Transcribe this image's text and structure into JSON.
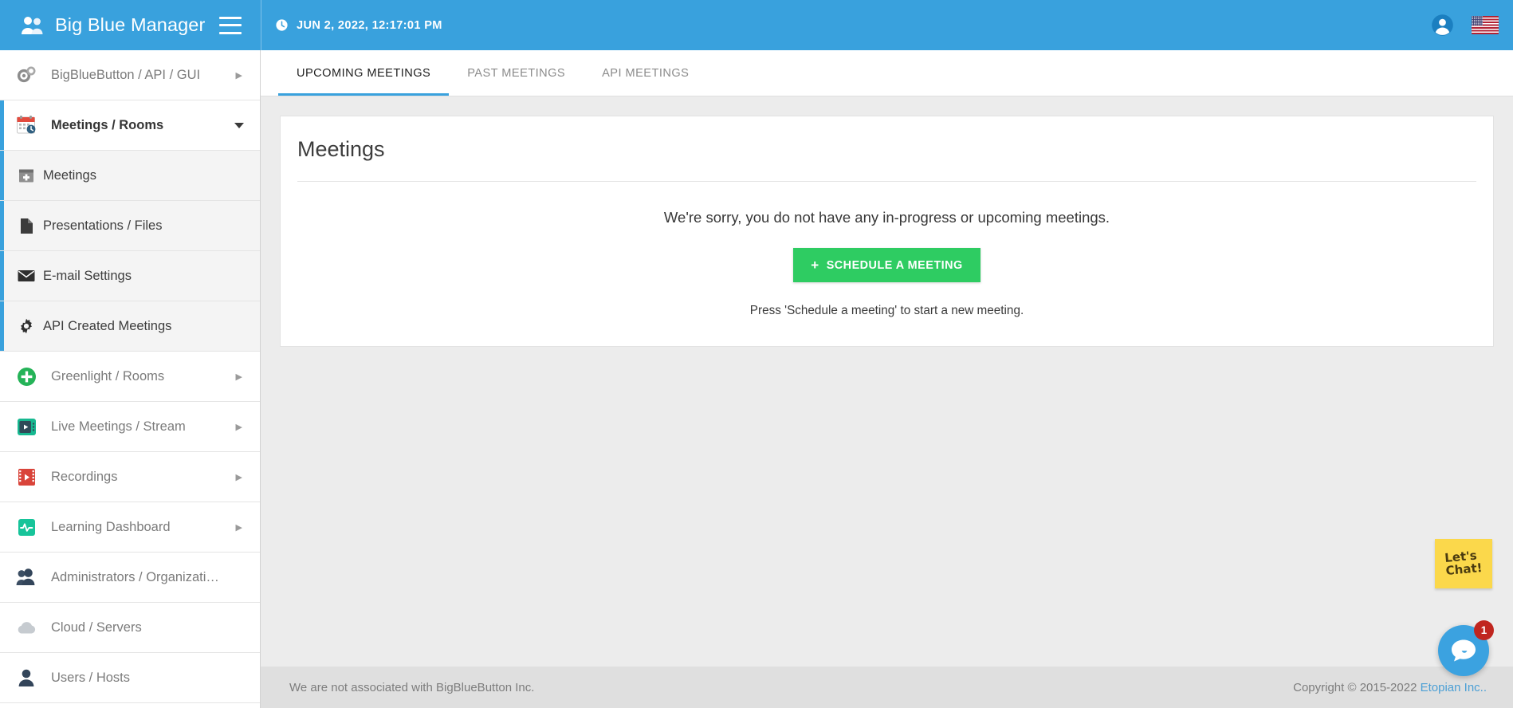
{
  "topbar": {
    "brand_title": "Big Blue Manager",
    "brand_icon": "users-icon",
    "menu_icon": "hamburger-icon",
    "clock_icon": "clock-icon",
    "datetime": "JUN 2, 2022, 12:17:01 PM",
    "account_icon": "account-circle-icon",
    "flag_icon": "us-flag-icon"
  },
  "sidebar": {
    "items": [
      {
        "label": "BigBlueButton / API / GUI",
        "icon": "gears-icon",
        "type": "top",
        "expand": "caret-right"
      },
      {
        "label": "Meetings / Rooms",
        "icon": "calendar-clock-icon",
        "type": "top-active",
        "expand": "caret-down"
      },
      {
        "label": "Meetings",
        "icon": "calendar-plus-icon",
        "type": "sub"
      },
      {
        "label": "Presentations / Files",
        "icon": "file-icon",
        "type": "sub"
      },
      {
        "label": "E-mail Settings",
        "icon": "envelope-icon",
        "type": "sub"
      },
      {
        "label": "API Created Meetings",
        "icon": "gear-icon",
        "type": "sub"
      },
      {
        "label": "Greenlight / Rooms",
        "icon": "plus-circle-icon",
        "type": "top",
        "expand": "caret-right"
      },
      {
        "label": "Live Meetings / Stream",
        "icon": "tv-play-icon",
        "type": "top",
        "expand": "caret-right"
      },
      {
        "label": "Recordings",
        "icon": "film-play-icon",
        "type": "top",
        "expand": "caret-right"
      },
      {
        "label": "Learning Dashboard",
        "icon": "pulse-icon",
        "type": "top",
        "expand": "caret-right"
      },
      {
        "label": "Administrators / Organizati…",
        "icon": "users-group-icon",
        "type": "top"
      },
      {
        "label": "Cloud / Servers",
        "icon": "cloud-icon",
        "type": "top"
      },
      {
        "label": "Users / Hosts",
        "icon": "user-icon",
        "type": "top"
      }
    ]
  },
  "tabs": [
    {
      "label": "UPCOMING MEETINGS",
      "active": true
    },
    {
      "label": "PAST MEETINGS",
      "active": false
    },
    {
      "label": "API MEETINGS",
      "active": false
    }
  ],
  "card": {
    "title": "Meetings",
    "empty_message": "We're sorry, you do not have any in-progress or upcoming meetings.",
    "schedule_button": "SCHEDULE A MEETING",
    "schedule_plus": "+",
    "hint": "Press 'Schedule a meeting' to start a new meeting."
  },
  "footer": {
    "left": "We are not associated with BigBlueButton Inc.",
    "copyright": "Copyright © 2015-2022 ",
    "link": "Etopian Inc..",
    "link_suffix": ""
  },
  "chat": {
    "note_line1": "Let's",
    "note_line2": "Chat!",
    "badge": "1",
    "bubble_icon": "chat-bubble-icon"
  },
  "colors": {
    "brand_blue": "#39a1dd",
    "green": "#2ecc62",
    "badge_red": "#c0261f",
    "note_yellow": "#fbd84b"
  }
}
